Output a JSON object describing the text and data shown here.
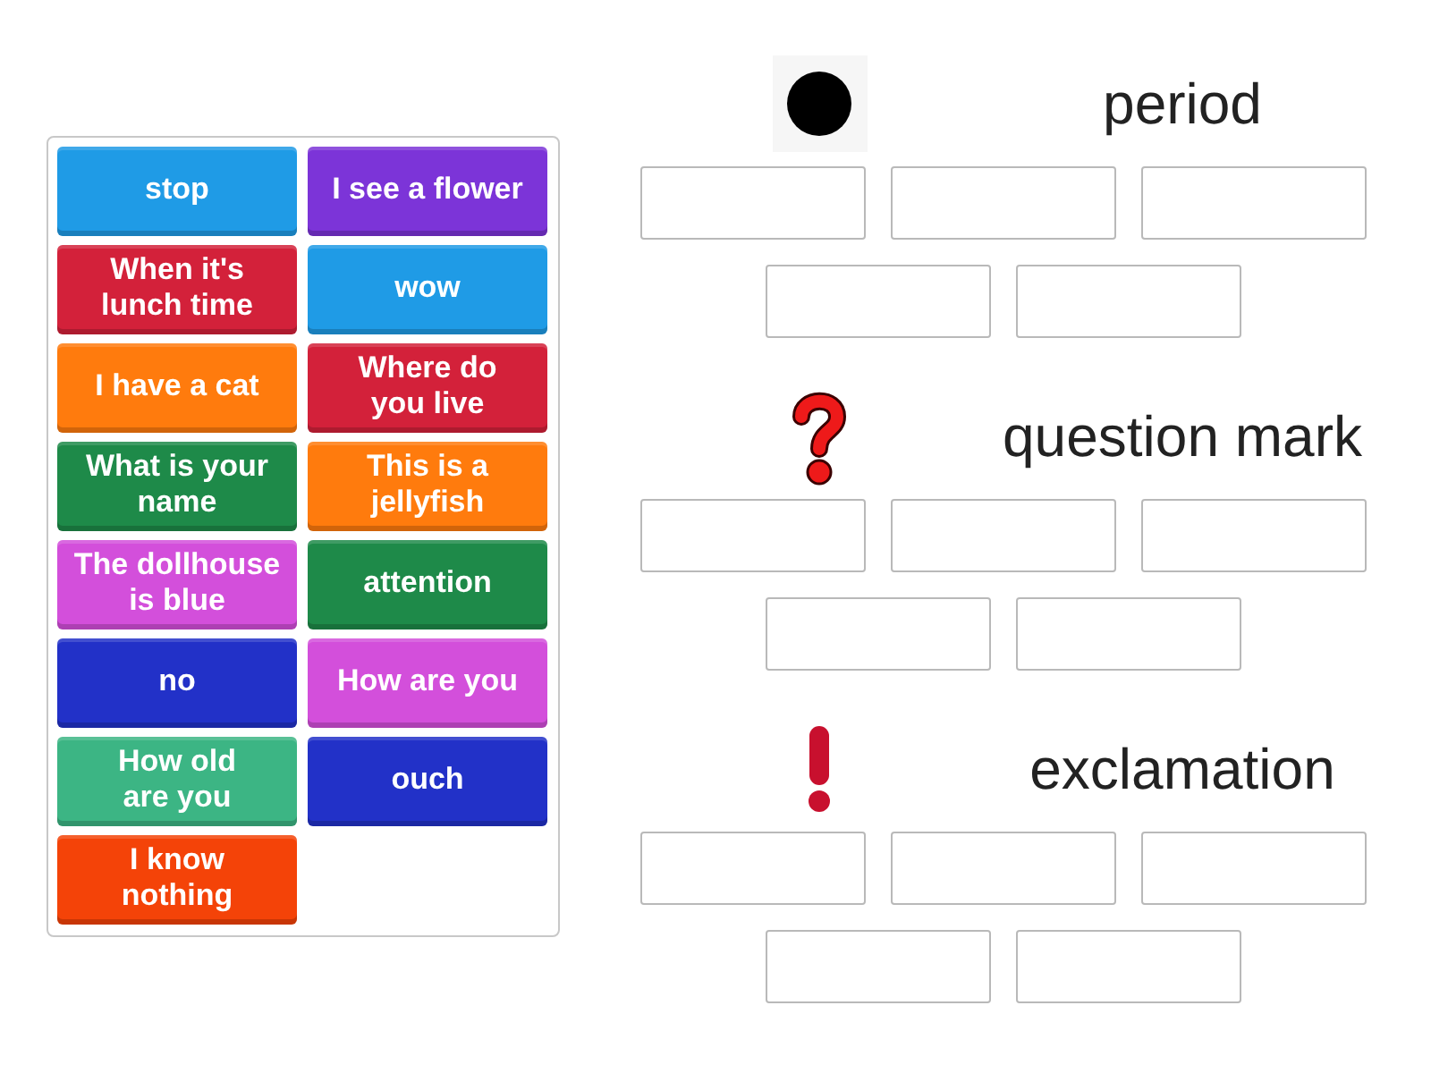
{
  "cards": [
    {
      "text": "stop",
      "color": "#1f9be6"
    },
    {
      "text": "I see a flower",
      "color": "#7c34d8"
    },
    {
      "text": "When it's lunch time",
      "color": "#d3213a"
    },
    {
      "text": "wow",
      "color": "#1f9be6"
    },
    {
      "text": "I have a cat",
      "color": "#ff7b0d"
    },
    {
      "text": "Where do you live",
      "color": "#d3213a"
    },
    {
      "text": "What is your name",
      "color": "#1e8a49"
    },
    {
      "text": "This is a jellyfish",
      "color": "#ff7b0d"
    },
    {
      "text": "The dollhouse is blue",
      "color": "#d34fdb"
    },
    {
      "text": "attention",
      "color": "#1e8a49"
    },
    {
      "text": "no",
      "color": "#2231c8"
    },
    {
      "text": "How are you",
      "color": "#d34fdb"
    },
    {
      "text": "How old are you",
      "color": "#3cb584"
    },
    {
      "text": "ouch",
      "color": "#2231c8"
    },
    {
      "text": "I know nothing",
      "color": "#f44308"
    }
  ],
  "groups": [
    {
      "kind": "dot",
      "label": "period",
      "answer_boxes": [
        {
          "empty": true
        },
        {
          "empty": true
        },
        {
          "empty": true
        },
        {
          "empty": true
        },
        {
          "empty": true
        }
      ]
    },
    {
      "kind": "question",
      "label": "question mark",
      "answer_boxes": [
        {
          "empty": true
        },
        {
          "empty": true
        },
        {
          "empty": true
        },
        {
          "empty": true
        },
        {
          "empty": true
        }
      ]
    },
    {
      "kind": "exclamation",
      "label": "exclamation",
      "answer_boxes": [
        {
          "empty": true
        },
        {
          "empty": true
        },
        {
          "empty": true
        },
        {
          "empty": true
        },
        {
          "empty": true
        }
      ]
    }
  ]
}
